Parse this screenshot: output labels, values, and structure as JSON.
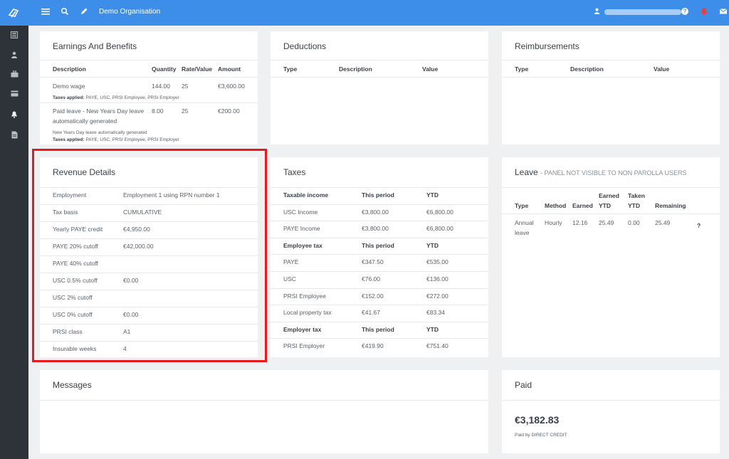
{
  "topbar": {
    "org": "Demo Organisation",
    "icons": [
      "menu-icon",
      "search-icon",
      "pencil-icon",
      "user-icon",
      "help-icon",
      "alert-icon",
      "mail-icon"
    ]
  },
  "sidebar": {
    "icons": [
      "dashboard-icon",
      "people-icon",
      "briefcase-icon",
      "payroll-icon",
      "bell-icon",
      "document-icon"
    ]
  },
  "earnings": {
    "title": "Earnings And Benefits",
    "headers": [
      "Description",
      "Quantity",
      "Rate/Value",
      "Amount"
    ],
    "rows": [
      {
        "desc": "Demo wage",
        "qty": "144.00",
        "rate": "25",
        "amount": "€3,600.00",
        "note": "",
        "taxes_label": "Taxes applied:",
        "taxes": "PAYE, USC, PRSI Employee, PRSI Employer"
      },
      {
        "desc_line1": "Paid leave - New Years Day leave",
        "desc_line2": "automatically generated",
        "qty": "8.00",
        "rate": "25",
        "amount": "€200.00",
        "note": "New Years Day leave automatically generated",
        "taxes_label": "Taxes applied:",
        "taxes": "PAYE, USC, PRSI Employee, PRSI Employer"
      }
    ]
  },
  "deductions": {
    "title": "Deductions",
    "headers": [
      "Type",
      "Description",
      "Value"
    ]
  },
  "reimbursements": {
    "title": "Reimbursements",
    "headers": [
      "Type",
      "Description",
      "Value"
    ]
  },
  "revenue": {
    "title": "Revenue Details",
    "rows": [
      {
        "label": "Employment",
        "value": "Employment 1 using RPN number 1"
      },
      {
        "label": "Tax basis",
        "value": "CUMULATIVE"
      },
      {
        "label": "Yearly PAYE credit",
        "value": "€4,950.00"
      },
      {
        "label": "PAYE 20% cutoff",
        "value": "€42,000.00"
      },
      {
        "label": "PAYE 40% cutoff",
        "value": ""
      },
      {
        "label": "USC 0.5% cutoff",
        "value": "€0.00"
      },
      {
        "label": "USC 2% cutoff",
        "value": ""
      },
      {
        "label": "USC 0% cutoff",
        "value": "€0.00"
      },
      {
        "label": "PRSI class",
        "value": "A1"
      },
      {
        "label": "Insurable weeks",
        "value": "4"
      }
    ]
  },
  "taxes": {
    "title": "Taxes",
    "rows": [
      {
        "a": "Taxable income",
        "b": "This period",
        "c": "YTD",
        "header": true
      },
      {
        "a": "USC Income",
        "b": "€3,800.00",
        "c": "€6,800.00",
        "header": false
      },
      {
        "a": "PAYE Income",
        "b": "€3,800.00",
        "c": "€6,800.00",
        "header": false
      },
      {
        "a": "Employee tax",
        "b": "This period",
        "c": "YTD",
        "header": true
      },
      {
        "a": "PAYE",
        "b": "€347.50",
        "c": "€535.00",
        "header": false
      },
      {
        "a": "USC",
        "b": "€76.00",
        "c": "€136.00",
        "header": false
      },
      {
        "a": "PRSI Employee",
        "b": "€152.00",
        "c": "€272.00",
        "header": false
      },
      {
        "a": "Local property tax",
        "b": "€41.67",
        "c": "€83.34",
        "header": false
      },
      {
        "a": "Employer tax",
        "b": "This period",
        "c": "YTD",
        "header": true
      },
      {
        "a": "PRSI Employer",
        "b": "€419.90",
        "c": "€751.40",
        "header": false
      }
    ]
  },
  "leave": {
    "title": "Leave",
    "subtitle": "- PANEL NOT VISIBLE TO NON PAROLLA USERS",
    "headers": {
      "type": "Type",
      "method": "Method",
      "earned": "Earned",
      "earned_ytd_1": "Earned",
      "earned_ytd_2": "YTD",
      "taken_ytd_1": "Taken",
      "taken_ytd_2": "YTD",
      "remaining": "Remaining"
    },
    "row": {
      "type_1": "Annual",
      "type_2": "leave",
      "method": "Hourly",
      "earned": "12.16",
      "earned_ytd": "25.49",
      "taken_ytd": "0.00",
      "remaining": "25.49",
      "help": "?"
    }
  },
  "messages": {
    "title": "Messages"
  },
  "paid": {
    "title": "Paid",
    "amount": "€3,182.83",
    "method": "Paid by DIRECT CREDIT"
  },
  "colors": {
    "topbar": "#3d8ee8",
    "sidebar": "#2d3339",
    "highlight": "#e8181c"
  }
}
